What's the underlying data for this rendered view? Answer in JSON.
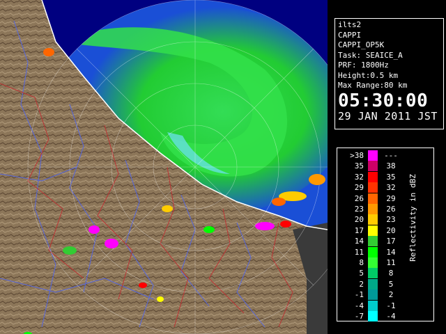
{
  "info": {
    "station": "ilts2",
    "product": "CAPPI",
    "product_id": "CAPPI_OP5K",
    "task": "Task: SEAICE_A",
    "prf": "PRF: 1800Hz",
    "height": "Height:0.5 km",
    "max_range": "Max Range:80 km",
    "time": "05:30:00",
    "date": "29 JAN 2011 JST"
  },
  "legend": {
    "title": "Reflectivity in dBZ",
    "rows": [
      {
        "lo": ">38",
        "hi": "---",
        "color": "#ff00ff"
      },
      {
        "lo": "35",
        "hi": "38",
        "color": "#cc0066"
      },
      {
        "lo": "32",
        "hi": "35",
        "color": "#ff0000"
      },
      {
        "lo": "29",
        "hi": "32",
        "color": "#ff3300"
      },
      {
        "lo": "26",
        "hi": "29",
        "color": "#ff6600"
      },
      {
        "lo": "23",
        "hi": "26",
        "color": "#ff9900"
      },
      {
        "lo": "20",
        "hi": "23",
        "color": "#ffcc00"
      },
      {
        "lo": "17",
        "hi": "20",
        "color": "#ffff00"
      },
      {
        "lo": "14",
        "hi": "17",
        "color": "#33cc33"
      },
      {
        "lo": "11",
        "hi": "14",
        "color": "#00ff00"
      },
      {
        "lo": "8",
        "hi": "11",
        "color": "#33ff33"
      },
      {
        "lo": "5",
        "hi": "8",
        "color": "#00cc66"
      },
      {
        "lo": "2",
        "hi": "5",
        "color": "#00aa88"
      },
      {
        "lo": "-1",
        "hi": "2",
        "color": "#009999"
      },
      {
        "lo": "-4",
        "hi": "-1",
        "color": "#00cccc"
      },
      {
        "lo": "-7",
        "hi": "-4",
        "color": "#00ffff"
      }
    ]
  },
  "colors": {
    "ocean": "#1a4fd6",
    "land": "#8c7659",
    "echo": "#22dd22",
    "outside": "#000080",
    "coast": "#ffffff",
    "rivers": "#5566dd",
    "borders": "#bb3333"
  }
}
